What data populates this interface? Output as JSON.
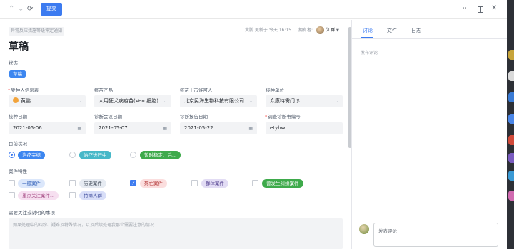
{
  "toolbar": {
    "submit_label": "提交",
    "back_icon": "chevron-up-icon",
    "forward_icon": "chevron-down-icon",
    "refresh_icon": "refresh-icon"
  },
  "header": {
    "breadcrumb": "异常反应措施等级评定通知",
    "meta_text": "黄鹏 更新于 今天 16:15",
    "owner_label": "拥有者:",
    "owner_name": "江群",
    "title": "草稿"
  },
  "status": {
    "label": "状态",
    "value": "草稿"
  },
  "fields": {
    "recipient": {
      "label": "受种人信息表",
      "value": "黄鹏"
    },
    "vaccine": {
      "label": "疫苗产品",
      "value": "人用狂犬病疫苗(Vero细胞)"
    },
    "licensee": {
      "label": "疫苗上市许可人",
      "value": "北京民海生物科技有限公司"
    },
    "unit": {
      "label": "接种单位",
      "value": "众康特需门诊"
    },
    "vacc_date": {
      "label": "接种日期",
      "value": "2021-05-06"
    },
    "meeting_date": {
      "label": "诊断会议日期",
      "value": "2021-05-07"
    },
    "report_date": {
      "label": "诊断报告日期",
      "value": "2021-05-22"
    },
    "diag_no": {
      "label": "调查诊断书编号",
      "value": "etyhw"
    }
  },
  "current_status": {
    "label": "目前状况",
    "options": [
      "治疗完结",
      "治疗进行中",
      "暂时稳定、后..."
    ]
  },
  "case_traits": {
    "label": "案件特性",
    "options": [
      "一般案件",
      "历史案件",
      "死亡案件",
      "群体案件",
      "曾发生纠纷案件",
      "重点关注案件...",
      "特殊人群"
    ]
  },
  "notes": {
    "label": "需要关注或说明的事项",
    "placeholder": "如果处理中的纠纷、疑难及特殊情况，以及后续处理我那个需要注意的情况"
  },
  "side_panel": {
    "tabs": [
      "讨论",
      "文件",
      "日志"
    ],
    "comment_hint": "发布评论",
    "comment_placeholder": "发表评论"
  },
  "colors": {
    "accent": "#3c7bf0",
    "tag_blue": "#3c86f0",
    "tag_teal": "#47b8c8",
    "tag_green": "#3eaa4b"
  }
}
